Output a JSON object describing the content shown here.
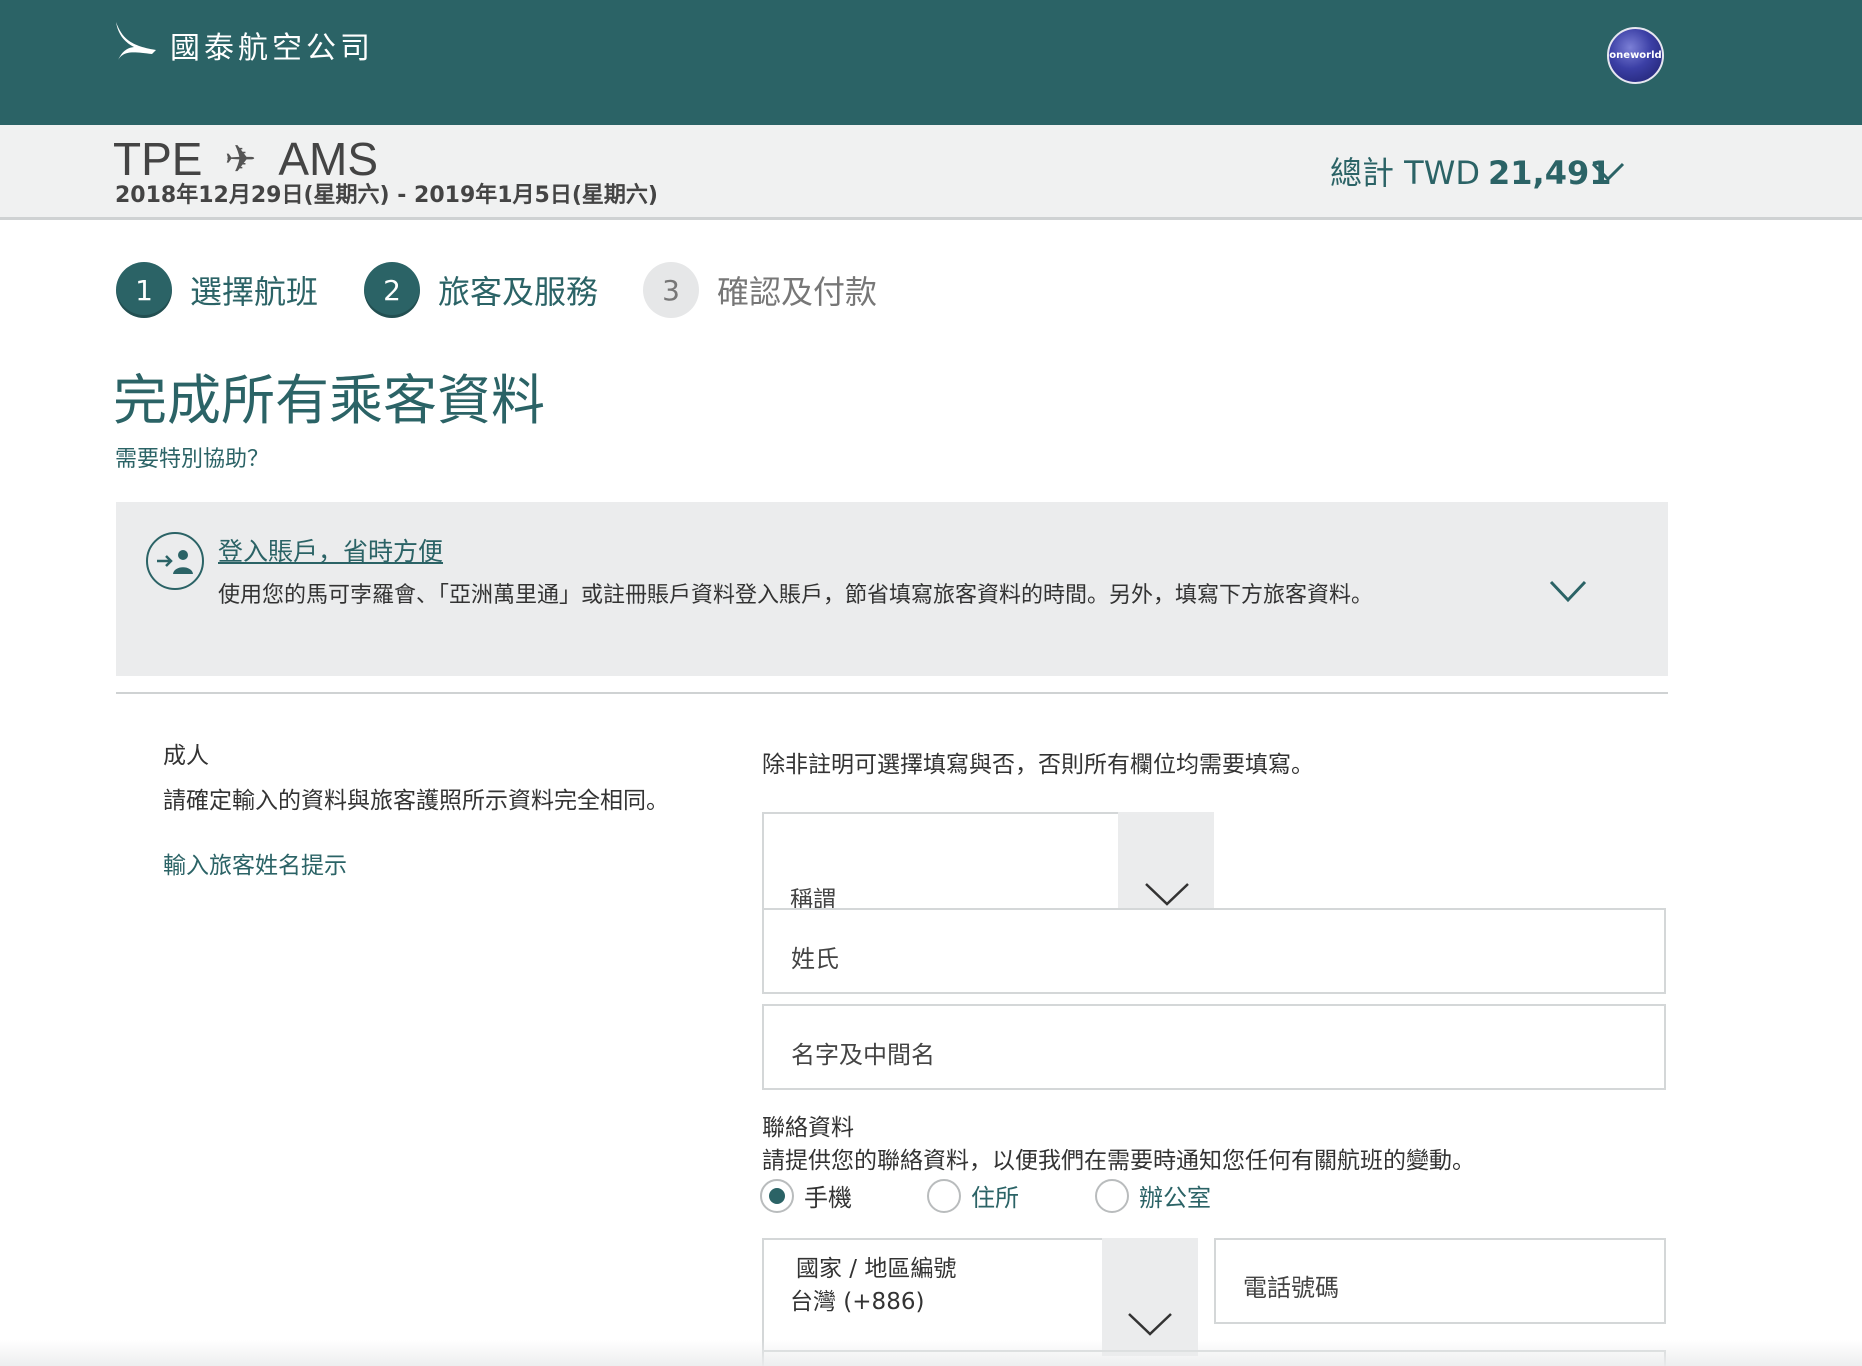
{
  "header": {
    "brand_name": "國泰航空公司",
    "alliance_badge": "oneworld"
  },
  "trip": {
    "origin": "TPE",
    "destination": "AMS",
    "dates": "2018年12月29日(星期六) - 2019年1月5日(星期六)",
    "total_label": "總計 TWD",
    "total_amount": "21,491"
  },
  "steps": [
    {
      "number": "1",
      "label": "選擇航班",
      "state": "active"
    },
    {
      "number": "2",
      "label": "旅客及服務",
      "state": "active"
    },
    {
      "number": "3",
      "label": "確認及付款",
      "state": "inactive"
    }
  ],
  "page": {
    "title": "完成所有乘客資料",
    "help_link": "需要特別協助？"
  },
  "login_banner": {
    "link": "登入賬戶，省時方便",
    "description": "使用您的馬可孛羅會、「亞洲萬里通」或註冊賬戶資料登入賬戶，節省填寫旅客資料的時間。另外，填寫下方旅客資料。"
  },
  "passenger": {
    "type": "成人",
    "note": "請確定輸入的資料與旅客護照所示資料完全相同。",
    "name_tip": "輸入旅客姓名提示"
  },
  "form": {
    "note": "除非註明可選擇填寫與否，否則所有欄位均需要填寫。",
    "title_label": "稱謂",
    "surname_label": "姓氏",
    "given_name_label": "名字及中間名",
    "contact_heading": "聯絡資料",
    "contact_note": "請提供您的聯絡資料，以便我們在需要時通知您任何有關航班的變動。",
    "phone_types": [
      {
        "label": "手機",
        "selected": true
      },
      {
        "label": "住所",
        "selected": false
      },
      {
        "label": "辦公室",
        "selected": false
      }
    ],
    "country_code_label": "國家 / 地區編號",
    "country_code_value": "台灣 (+886)",
    "phone_label": "電話號碼"
  },
  "colors": {
    "brand": "#2b6366",
    "panel": "#ebeced",
    "border": "#d4d7d8"
  }
}
